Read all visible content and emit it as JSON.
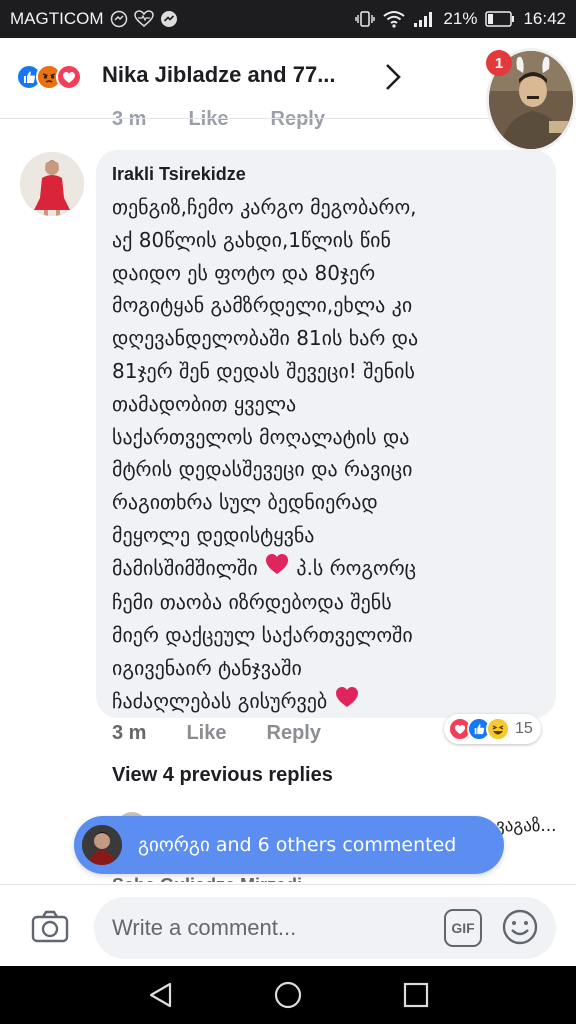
{
  "status_bar": {
    "carrier": "MAGTICOM",
    "battery_percent": "21%",
    "time": "16:42"
  },
  "header": {
    "title": "Nika Jibladze and 77...",
    "reactions": [
      "like-icon",
      "angry-icon",
      "love-icon"
    ],
    "chathead_badge": "1"
  },
  "previous_actions": {
    "time": "3 m",
    "like": "Like",
    "reply": "Reply"
  },
  "comment": {
    "author": "Irakli Tsirekidze",
    "lines": [
      "თენგიზ,ჩემო კარგო მეგობარო,",
      "აქ 80წლის გახდი,1წლის წინ",
      "დაიდო ეს ფოტო და 80ჯერ",
      "მოგიტყან გამზრდელი,ეხლა კი",
      "დღევანდელობაში 81ის ხარ და",
      "81ჯერ შენ დედას შევეცი! შენის",
      "თამადობით ყველა",
      "საქართველოს მოღალატის და",
      "მტრის დედასშევეცი და რავიცი",
      "რაგითხრა სულ ბედნიერად",
      "მეყოლე დედისტყვნა",
      "მამისშიმშილში",
      "ჩემი თაობა იზრდებოდა შენს",
      "მიერ დაქცეულ საქართველოში",
      "იგივენაირ ტანჯვაში",
      "ჩაძაღლებას გისურვებ"
    ],
    "line_12_suffix": "პ.ს როგორც",
    "time": "3 m",
    "like_label": "Like",
    "reply_label": "Reply",
    "reaction_count": "15",
    "reaction_icons": [
      "love-icon",
      "like-icon",
      "haha-icon"
    ]
  },
  "view_previous_replies": "View 4 previous replies",
  "hidden_reply_tail": "ვაგაზ...",
  "hidden_reply_name": "Saba Guliadze Mirzadi",
  "notification_pill": {
    "text": "გიორგი and 6 others commented"
  },
  "composer": {
    "placeholder": "Write a comment...",
    "gif_label": "GIF"
  },
  "colors": {
    "facebook_blue": "#1877f2",
    "pill_blue": "#5b8ef0",
    "bubble_gray": "#f0f2f5",
    "heart_red": "#e0245e"
  }
}
